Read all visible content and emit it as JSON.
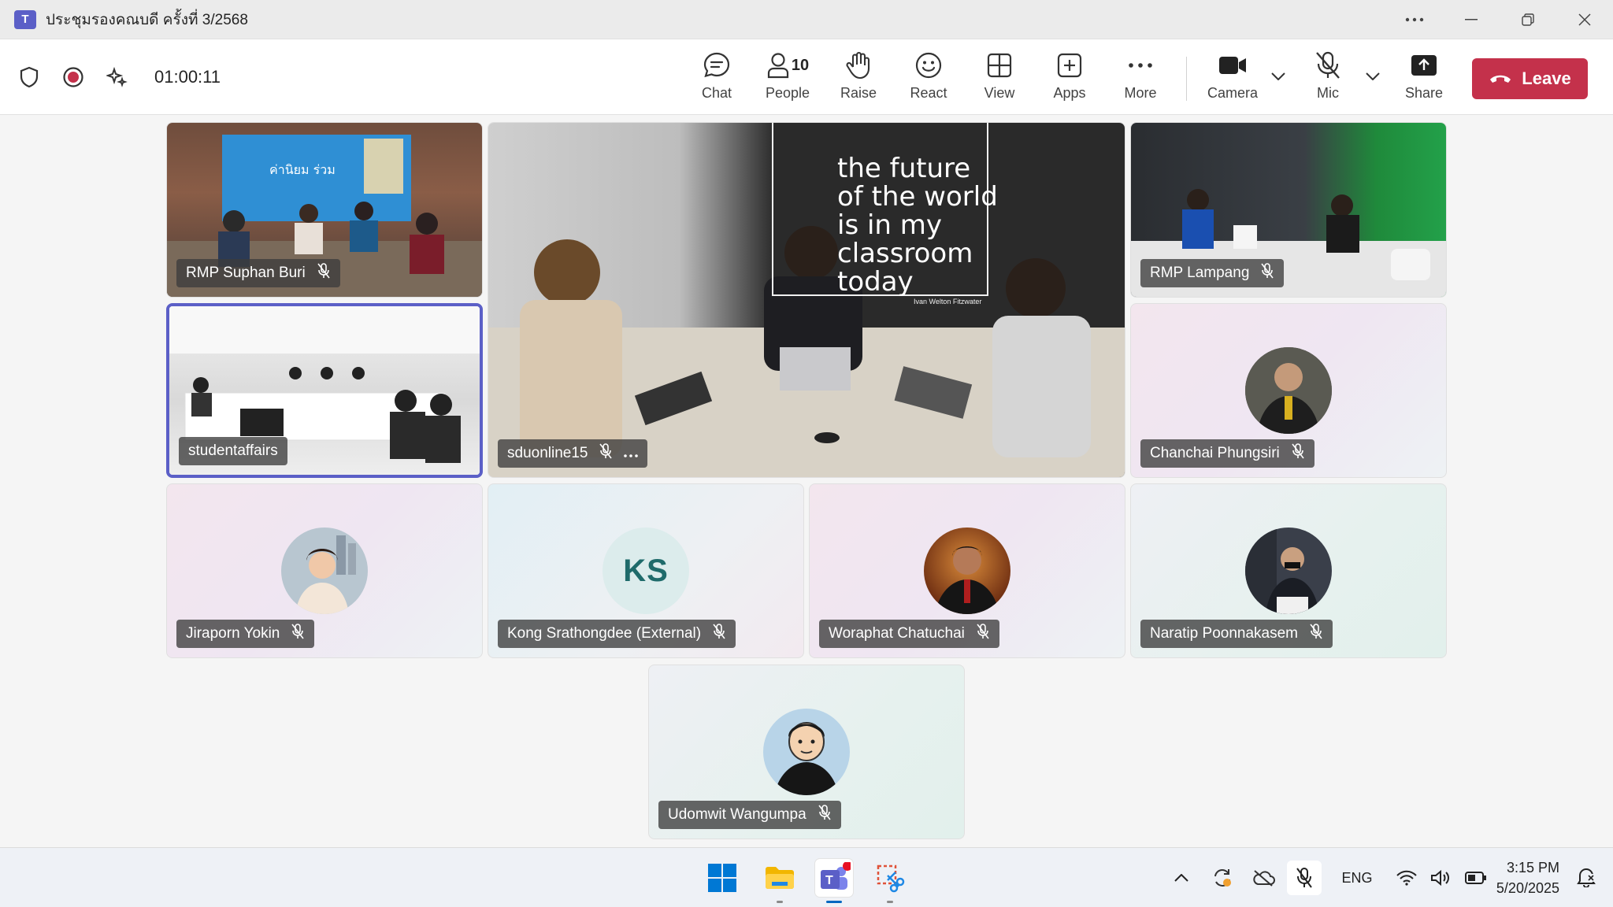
{
  "window": {
    "title": "ประชุมรองคณบดี ครั้งที่ 3/2568",
    "app_icon_letter": "T"
  },
  "toolbar": {
    "timer": "01:00:11",
    "buttons": {
      "chat": "Chat",
      "people": "People",
      "people_count": "10",
      "raise": "Raise",
      "react": "React",
      "view": "View",
      "apps": "Apps",
      "more": "More",
      "camera": "Camera",
      "mic": "Mic",
      "share": "Share",
      "leave": "Leave"
    }
  },
  "participants": [
    {
      "name": "RMP Suphan Buri",
      "muted": true,
      "type": "video"
    },
    {
      "name": "sduonline15",
      "muted": true,
      "type": "video",
      "pinned_large": true
    },
    {
      "name": "RMP Lampang",
      "muted": true,
      "type": "video"
    },
    {
      "name": "studentaffairs",
      "muted": false,
      "type": "video",
      "active_speaker": true
    },
    {
      "name": "Chanchai Phungsiri",
      "muted": true,
      "type": "avatar"
    },
    {
      "name": "Jiraporn Yokin",
      "muted": true,
      "type": "avatar"
    },
    {
      "name": "Kong Srathongdee (External)",
      "muted": true,
      "type": "initials",
      "initials": "KS"
    },
    {
      "name": "Woraphat Chatuchai",
      "muted": true,
      "type": "avatar"
    },
    {
      "name": "Naratip Poonnakasem",
      "muted": true,
      "type": "avatar"
    },
    {
      "name": "Udomwit Wangumpa",
      "muted": true,
      "type": "avatar"
    }
  ],
  "scene_text": {
    "quote": [
      "the future",
      "of the world",
      "is in my",
      "classroom",
      "today"
    ],
    "quote_author": "Ivan Welton Fitzwater",
    "banner": "ค่านิยม ร่วม"
  },
  "taskbar": {
    "language": "ENG",
    "time": "3:15 PM",
    "date": "5/20/2025"
  },
  "colors": {
    "accent": "#5b5fc7",
    "leave": "#c4314b",
    "recording": "#c4314b"
  }
}
